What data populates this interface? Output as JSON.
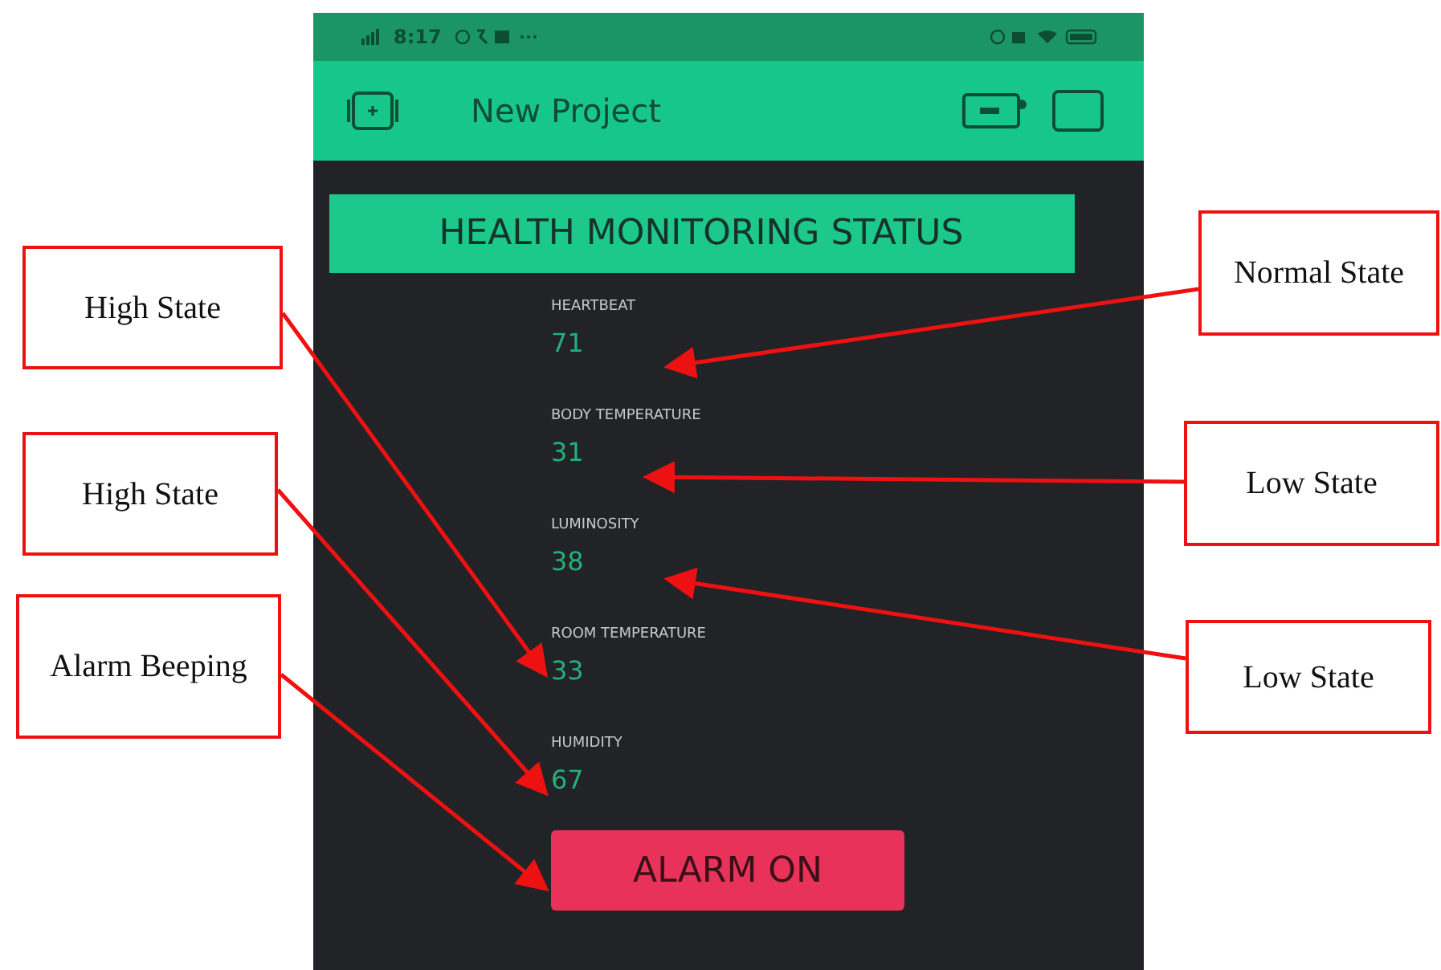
{
  "status_bar": {
    "time": "8:17"
  },
  "header": {
    "title": "New Project"
  },
  "banner": {
    "text": "HEALTH MONITORING STATUS"
  },
  "readings": [
    {
      "label": "HEARTBEAT",
      "value": "71"
    },
    {
      "label": "BODY TEMPERATURE",
      "value": "31"
    },
    {
      "label": "LUMINOSITY",
      "value": "38"
    },
    {
      "label": "ROOM TEMPERATURE",
      "value": "33"
    },
    {
      "label": "HUMIDITY",
      "value": "67"
    }
  ],
  "alarm_button": {
    "label": "ALARM ON"
  },
  "annotations": [
    {
      "text": "High State"
    },
    {
      "text": "High State"
    },
    {
      "text": "Alarm Beeping"
    },
    {
      "text": "Normal State"
    },
    {
      "text": "Low State"
    },
    {
      "text": "Low State"
    }
  ]
}
